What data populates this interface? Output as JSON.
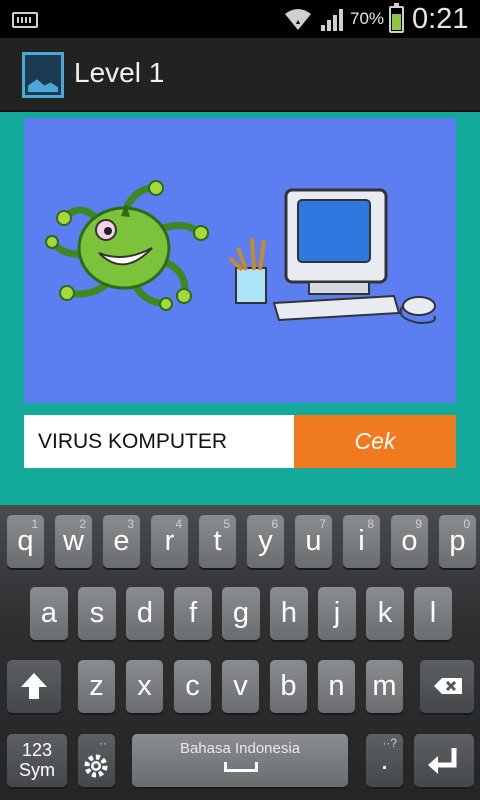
{
  "status_bar": {
    "battery_percent": "70%",
    "battery_level": 0.7,
    "time": "0:21"
  },
  "action_bar": {
    "title": "Level 1",
    "icon": "image-icon"
  },
  "main": {
    "picture": {
      "icon": "virus-and-computer-illustration"
    },
    "answer_input": {
      "value": "VIRUS KOMPUTER"
    },
    "check_button": {
      "label": "Cek"
    }
  },
  "colors": {
    "content_background": "#13a99b",
    "picture_background": "#5b7ff0",
    "check_button": "#f07a1e",
    "action_bar": "#222222"
  },
  "keyboard": {
    "row1": [
      {
        "label": "q",
        "hint": "1"
      },
      {
        "label": "w",
        "hint": "2"
      },
      {
        "label": "e",
        "hint": "3"
      },
      {
        "label": "r",
        "hint": "4"
      },
      {
        "label": "t",
        "hint": "5"
      },
      {
        "label": "y",
        "hint": "6"
      },
      {
        "label": "u",
        "hint": "7"
      },
      {
        "label": "i",
        "hint": "8"
      },
      {
        "label": "o",
        "hint": "9"
      },
      {
        "label": "p",
        "hint": "0"
      }
    ],
    "row2": [
      "a",
      "s",
      "d",
      "f",
      "g",
      "h",
      "j",
      "k",
      "l"
    ],
    "row3": [
      "z",
      "x",
      "c",
      "v",
      "b",
      "n",
      "m"
    ],
    "sym_label_1": "123",
    "sym_label_2": "Sym",
    "settings_hint": "··",
    "space_label": "Bahasa Indonesia",
    "period_label": ".",
    "period_hint": "··?",
    "shift_icon": "shift-arrow-icon",
    "backspace_icon": "backspace-icon",
    "enter_icon": "enter-icon",
    "settings_icon": "gear-icon"
  }
}
